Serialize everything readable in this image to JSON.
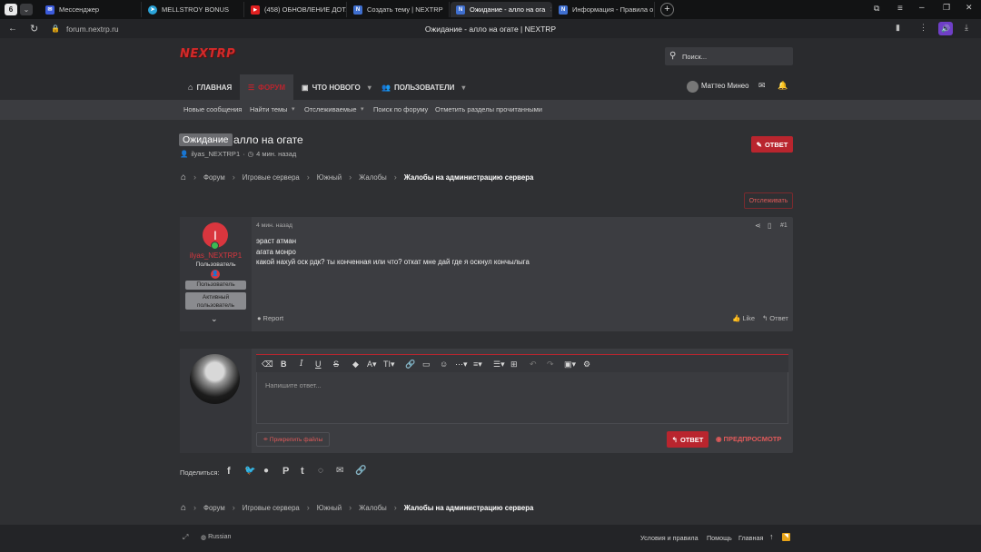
{
  "browser": {
    "workspace_badge": "6",
    "tabs": [
      {
        "title": "Мессенджер",
        "color": "#3b5bdb",
        "glyph": "✉"
      },
      {
        "title": "MELLSTROY BONUS",
        "color": "#2aa3d8",
        "glyph": "➤"
      },
      {
        "title": "(458) ОБНОВЛЕНИЕ ДОТА",
        "color": "#e02020",
        "glyph": "▶"
      },
      {
        "title": "Создать тему | NEXTRP",
        "color": "#3f6fcf",
        "glyph": "N"
      },
      {
        "title": "Ожидание - алло на ога",
        "color": "#3f6fcf",
        "glyph": "N"
      },
      {
        "title": "Информация - Правила о",
        "color": "#3f6fcf",
        "glyph": "N"
      }
    ],
    "address": "forum.nextrp.ru",
    "page_title": "Ожидание - алло на огате | NEXTRP"
  },
  "site": {
    "logo": "NEXTRP",
    "search_placeholder": "Поиск...",
    "nav": {
      "home": "ГЛАВНАЯ",
      "forums": "ФОРУМ",
      "whats_new": "ЧТО НОВОГО",
      "members": "ПОЛЬЗОВАТЕЛИ"
    },
    "user_name": "Маттео Минео",
    "subnav": [
      "Новые сообщения",
      "Найти темы",
      "Отслеживаемые",
      "Поиск по форуму",
      "Отметить разделы прочитанными"
    ]
  },
  "thread": {
    "prefix": "Ожидание",
    "title": "алло на огате",
    "author": "ilyas_NEXTRP1",
    "time": "4 мин. назад",
    "reply_button": "ОТВЕТ",
    "watch_button": "Отслеживать"
  },
  "breadcrumbs": [
    "Форум",
    "Игровые сервера",
    "Южный",
    "Жалобы",
    "Жалобы на администрацию сервера"
  ],
  "post": {
    "avatar_letter": "I",
    "username": "ilyas_NEXTRP1",
    "user_title": "Пользователь",
    "roles": [
      "Пользователь",
      "Активный пользователь"
    ],
    "time": "4 мин. назад",
    "number": "#1",
    "lines": [
      "эраст атман",
      "агата монро",
      "какой нахуй оск рдк? ты конченная или что? откат мне дай где я оскнул кончылыга"
    ],
    "report": "Report",
    "like": "Like",
    "reply": "Ответ"
  },
  "editor": {
    "placeholder": "Напишите ответ...",
    "attach": "Прикрепить файлы",
    "submit": "ОТВЕТ",
    "preview": "ПРЕДПРОСМОТР"
  },
  "share": {
    "label": "Поделиться:"
  },
  "footer": {
    "language": "Russian",
    "links": [
      "Условия и правила",
      "Помощь",
      "Главная"
    ]
  },
  "colors": {
    "accent": "#b9252e",
    "bg": "#2f3033",
    "panel": "#3c3d41"
  }
}
